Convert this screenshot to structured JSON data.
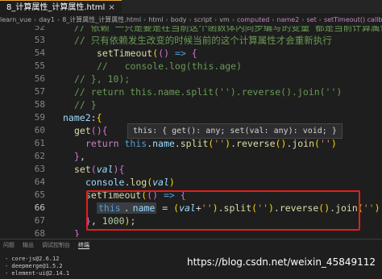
{
  "tab": {
    "title": "8_计算属性_计算属性.html"
  },
  "breadcrumb": [
    "learn_vue",
    "day1",
    "8_计算属性_计算属性.html",
    "html",
    "body",
    "script",
    "vm",
    "computed",
    "name2",
    "set",
    "setTimeout() callback"
  ],
  "lines": [
    {
      "n": "52",
      "tokens": [
        [
          "cm",
          "// 依赖 一只是要是在当前这个函数体内同步编写的变量 都是当前计算属性"
        ]
      ]
    },
    {
      "n": "53",
      "tokens": [
        [
          "cm",
          "// 只有依赖发生改变的时候当前的这个计算属性才会重新执行"
        ]
      ]
    },
    {
      "n": "54",
      "tokens": [
        [
          "fn",
          "setTimeout"
        ],
        [
          "brk",
          "("
        ],
        [
          "brk2",
          "("
        ],
        [
          "brk2",
          ")"
        ],
        [
          "kw",
          " =>"
        ],
        [
          "brk2",
          " {"
        ]
      ]
    },
    {
      "n": "55",
      "tokens": [
        [
          "cm",
          "//   console.log(this.age)"
        ]
      ]
    },
    {
      "n": "56",
      "tokens": [
        [
          "cm",
          "// }, 10);"
        ]
      ]
    },
    {
      "n": "57",
      "tokens": [
        [
          "cm",
          "// return this.name.split('').reverse().join('')"
        ]
      ]
    },
    {
      "n": "58",
      "tokens": [
        [
          "cm",
          "// }"
        ]
      ]
    },
    {
      "n": "59",
      "tokens": [
        [
          "prop",
          "name2"
        ],
        [
          "pun",
          ":"
        ],
        [
          "brk",
          "{"
        ]
      ]
    },
    {
      "n": "60",
      "tokens": [
        [
          "fn",
          "get"
        ],
        [
          "brk2",
          "()"
        ],
        [
          "brk2",
          "{"
        ]
      ]
    },
    {
      "n": "61",
      "tokens": [
        [
          "kw2",
          "return "
        ],
        [
          "kw",
          "this"
        ],
        [
          "pun",
          "."
        ],
        [
          "prop",
          "name"
        ],
        [
          "pun",
          "."
        ],
        [
          "fn",
          "split"
        ],
        [
          "brk",
          "("
        ],
        [
          "str",
          "''"
        ],
        [
          "brk",
          ")"
        ],
        [
          "pun",
          "."
        ],
        [
          "fn",
          "reverse"
        ],
        [
          "brk",
          "()"
        ],
        [
          "pun",
          "."
        ],
        [
          "fn",
          "join"
        ],
        [
          "brk",
          "("
        ],
        [
          "str",
          "''"
        ],
        [
          "brk",
          ")"
        ]
      ]
    },
    {
      "n": "62",
      "tokens": [
        [
          "brk2",
          "}"
        ],
        [
          "pun",
          ","
        ]
      ]
    },
    {
      "n": "63",
      "tokens": [
        [
          "fn",
          "set"
        ],
        [
          "brk2",
          "("
        ],
        [
          "param",
          "val"
        ],
        [
          "brk2",
          ")"
        ],
        [
          "brk2",
          "{"
        ]
      ]
    },
    {
      "n": "64",
      "tokens": [
        [
          "prop",
          "console"
        ],
        [
          "pun",
          "."
        ],
        [
          "fn",
          "log"
        ],
        [
          "brk",
          "("
        ],
        [
          "param",
          "val"
        ],
        [
          "brk",
          ")"
        ]
      ]
    },
    {
      "n": "65",
      "tokens": [
        [
          "fn",
          "setTimeout"
        ],
        [
          "brk",
          "("
        ],
        [
          "brk2",
          "("
        ],
        [
          "brk2",
          ")"
        ],
        [
          "kw",
          " =>"
        ],
        [
          "brk2",
          " {"
        ]
      ]
    },
    {
      "n": "66",
      "tokens": [
        [
          "kwhl",
          "this"
        ],
        [
          "punhl",
          "."
        ],
        [
          "prophl",
          "name"
        ],
        [
          "pun",
          " = "
        ],
        [
          "brk",
          "("
        ],
        [
          "param",
          "val"
        ],
        [
          "pun",
          "+"
        ],
        [
          "str",
          "''"
        ],
        [
          "brk",
          ")"
        ],
        [
          "pun",
          "."
        ],
        [
          "fn",
          "split"
        ],
        [
          "brk",
          "("
        ],
        [
          "str",
          "''"
        ],
        [
          "brk",
          ")"
        ],
        [
          "pun",
          "."
        ],
        [
          "fn",
          "reverse"
        ],
        [
          "brk",
          "()"
        ],
        [
          "pun",
          "."
        ],
        [
          "fn",
          "join"
        ],
        [
          "brk",
          "("
        ],
        [
          "str",
          "''"
        ],
        [
          "brk",
          ")"
        ]
      ]
    },
    {
      "n": "67",
      "tokens": [
        [
          "brk2",
          "}"
        ],
        [
          "pun",
          ", "
        ],
        [
          "num",
          "1000"
        ],
        [
          "brk",
          ")"
        ],
        [
          "pun",
          ";"
        ]
      ]
    },
    {
      "n": "68",
      "tokens": [
        [
          "brk2",
          "}"
        ]
      ]
    }
  ],
  "tooltip": {
    "text": "this: { get(): any; set(val: any): void; }"
  },
  "panel": {
    "tabs": [
      "问题",
      "输出",
      "调试控制台",
      "终端"
    ],
    "active_tab": "终端",
    "lines": [
      "core-js@2.6.12",
      "deepmerge@1.5.2",
      "element-ui@2.14.1"
    ]
  },
  "watermark": "https://blog.csdn.net/weixin_45849112"
}
